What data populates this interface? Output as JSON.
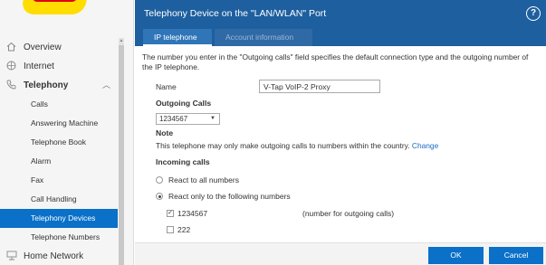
{
  "sidebar": {
    "items": [
      {
        "label": "Overview",
        "icon": "home-icon"
      },
      {
        "label": "Internet",
        "icon": "globe-icon"
      },
      {
        "label": "Telephony",
        "icon": "phone-icon",
        "expanded": true
      }
    ],
    "telephony_sub": [
      {
        "label": "Calls"
      },
      {
        "label": "Answering Machine"
      },
      {
        "label": "Telephone Book"
      },
      {
        "label": "Alarm"
      },
      {
        "label": "Fax"
      },
      {
        "label": "Call Handling"
      },
      {
        "label": "Telephony Devices",
        "active": true
      },
      {
        "label": "Telephone Numbers"
      }
    ],
    "after": [
      {
        "label": "Home Network",
        "icon": "network-icon"
      }
    ]
  },
  "header": {
    "title": "Telephony Device on the \"LAN/WLAN\" Port",
    "help": "?"
  },
  "tabs": [
    {
      "label": "IP telephone",
      "active": true
    },
    {
      "label": "Account information",
      "active": false
    }
  ],
  "form": {
    "intro": "The number you enter in the \"Outgoing calls\" field specifies the default connection type and the outgoing number of the IP telephone.",
    "name_label": "Name",
    "name_value": "V-Tap VoIP-2 Proxy",
    "outgoing_heading": "Outgoing Calls",
    "outgoing_selected": "1234567",
    "note_heading": "Note",
    "note_text": "This telephone may only make outgoing calls to numbers within the country.",
    "note_link": "Change",
    "incoming_heading": "Incoming calls",
    "radio_all": "React to all numbers",
    "radio_following": "React only to the following numbers",
    "numbers": [
      {
        "number": "1234567",
        "checked": true,
        "note": "(number for outgoing calls)"
      },
      {
        "number": "222",
        "checked": false,
        "note": ""
      }
    ]
  },
  "footer": {
    "ok_label": "OK",
    "cancel_label": "Cancel"
  },
  "colors": {
    "header_blue": "#1e5f9f",
    "accent_blue": "#0a70c8",
    "link_blue": "#1a6bc2"
  }
}
